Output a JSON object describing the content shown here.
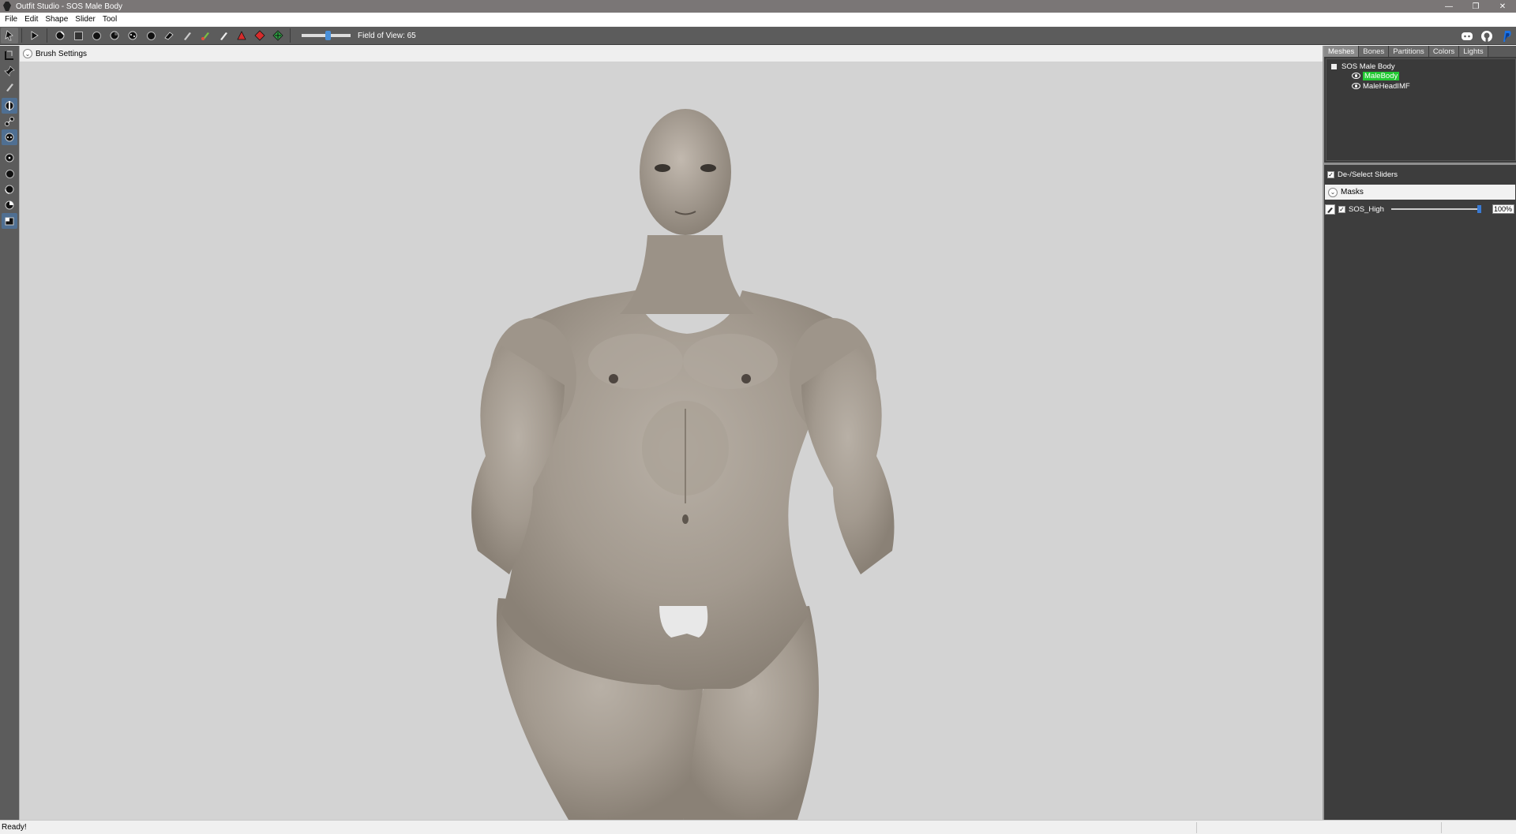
{
  "window": {
    "title": "Outfit Studio - SOS Male Body",
    "controls": [
      "minimize-icon",
      "restore-icon",
      "close-icon"
    ]
  },
  "menu": {
    "items": [
      "File",
      "Edit",
      "Shape",
      "Slider",
      "Tool"
    ]
  },
  "toolbar": {
    "fov_label": "Field of View: 65",
    "fov_value": 65,
    "tools": [
      "select-icon",
      "mask-brush-icon",
      "inflate-brush-icon",
      "deflate-brush-icon",
      "move-brush-icon",
      "smooth-brush-icon",
      "undiff-brush-icon",
      "weight-brush-icon",
      "color-brush-icon",
      "alpha-brush-icon",
      "collapse-vertex-icon",
      "flip-edge-icon",
      "split-edge-icon"
    ],
    "right_icons": [
      "discord-icon",
      "github-icon",
      "paypal-icon"
    ]
  },
  "brush_settings": {
    "label": "Brush Settings"
  },
  "right_panel": {
    "tabs": [
      "Meshes",
      "Bones",
      "Partitions",
      "Colors",
      "Lights"
    ],
    "active_tab": "Meshes",
    "tree": {
      "root": "SOS Male Body",
      "meshes": [
        "MaleBody",
        "MaleHeadIMF"
      ],
      "selected": "MaleBody"
    },
    "deselect_label": "De-/Select Sliders",
    "masks_label": "Masks",
    "sliders": [
      {
        "name": "SOS_High",
        "value_label": "100%",
        "value": 100
      }
    ]
  },
  "status": {
    "text": "Ready!"
  },
  "colors": {
    "selected_mesh": "#22c832",
    "viewport_bg": "#d3d3d3",
    "skin": "#a79e92"
  }
}
